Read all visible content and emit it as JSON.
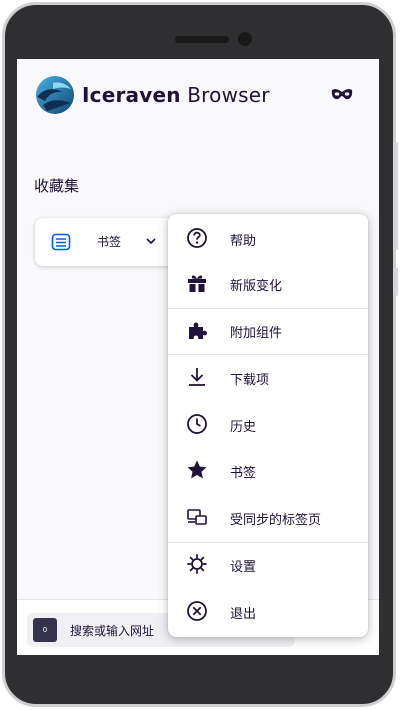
{
  "brand": {
    "name_bold": "Iceraven",
    "name_regular": "Browser"
  },
  "home": {
    "section_title": "收藏集",
    "collection": {
      "label": "书签"
    }
  },
  "toolbar": {
    "tab_count": "0",
    "search_placeholder": "搜索或输入网址"
  },
  "menu": {
    "items": [
      {
        "label": "帮助",
        "icon": "help-icon"
      },
      {
        "label": "新版变化",
        "icon": "gift-icon"
      },
      {
        "label": "附加组件",
        "icon": "puzzle-icon"
      },
      {
        "label": "下载项",
        "icon": "download-icon"
      },
      {
        "label": "历史",
        "icon": "clock-icon"
      },
      {
        "label": "书签",
        "icon": "star-icon"
      },
      {
        "label": "受同步的标签页",
        "icon": "synced-tabs-icon"
      },
      {
        "label": "设置",
        "icon": "gear-icon"
      },
      {
        "label": "退出",
        "icon": "close-circle-icon"
      }
    ]
  },
  "colors": {
    "text": "#20123a",
    "accent": "#312a65",
    "frame": "#2f2f31"
  }
}
